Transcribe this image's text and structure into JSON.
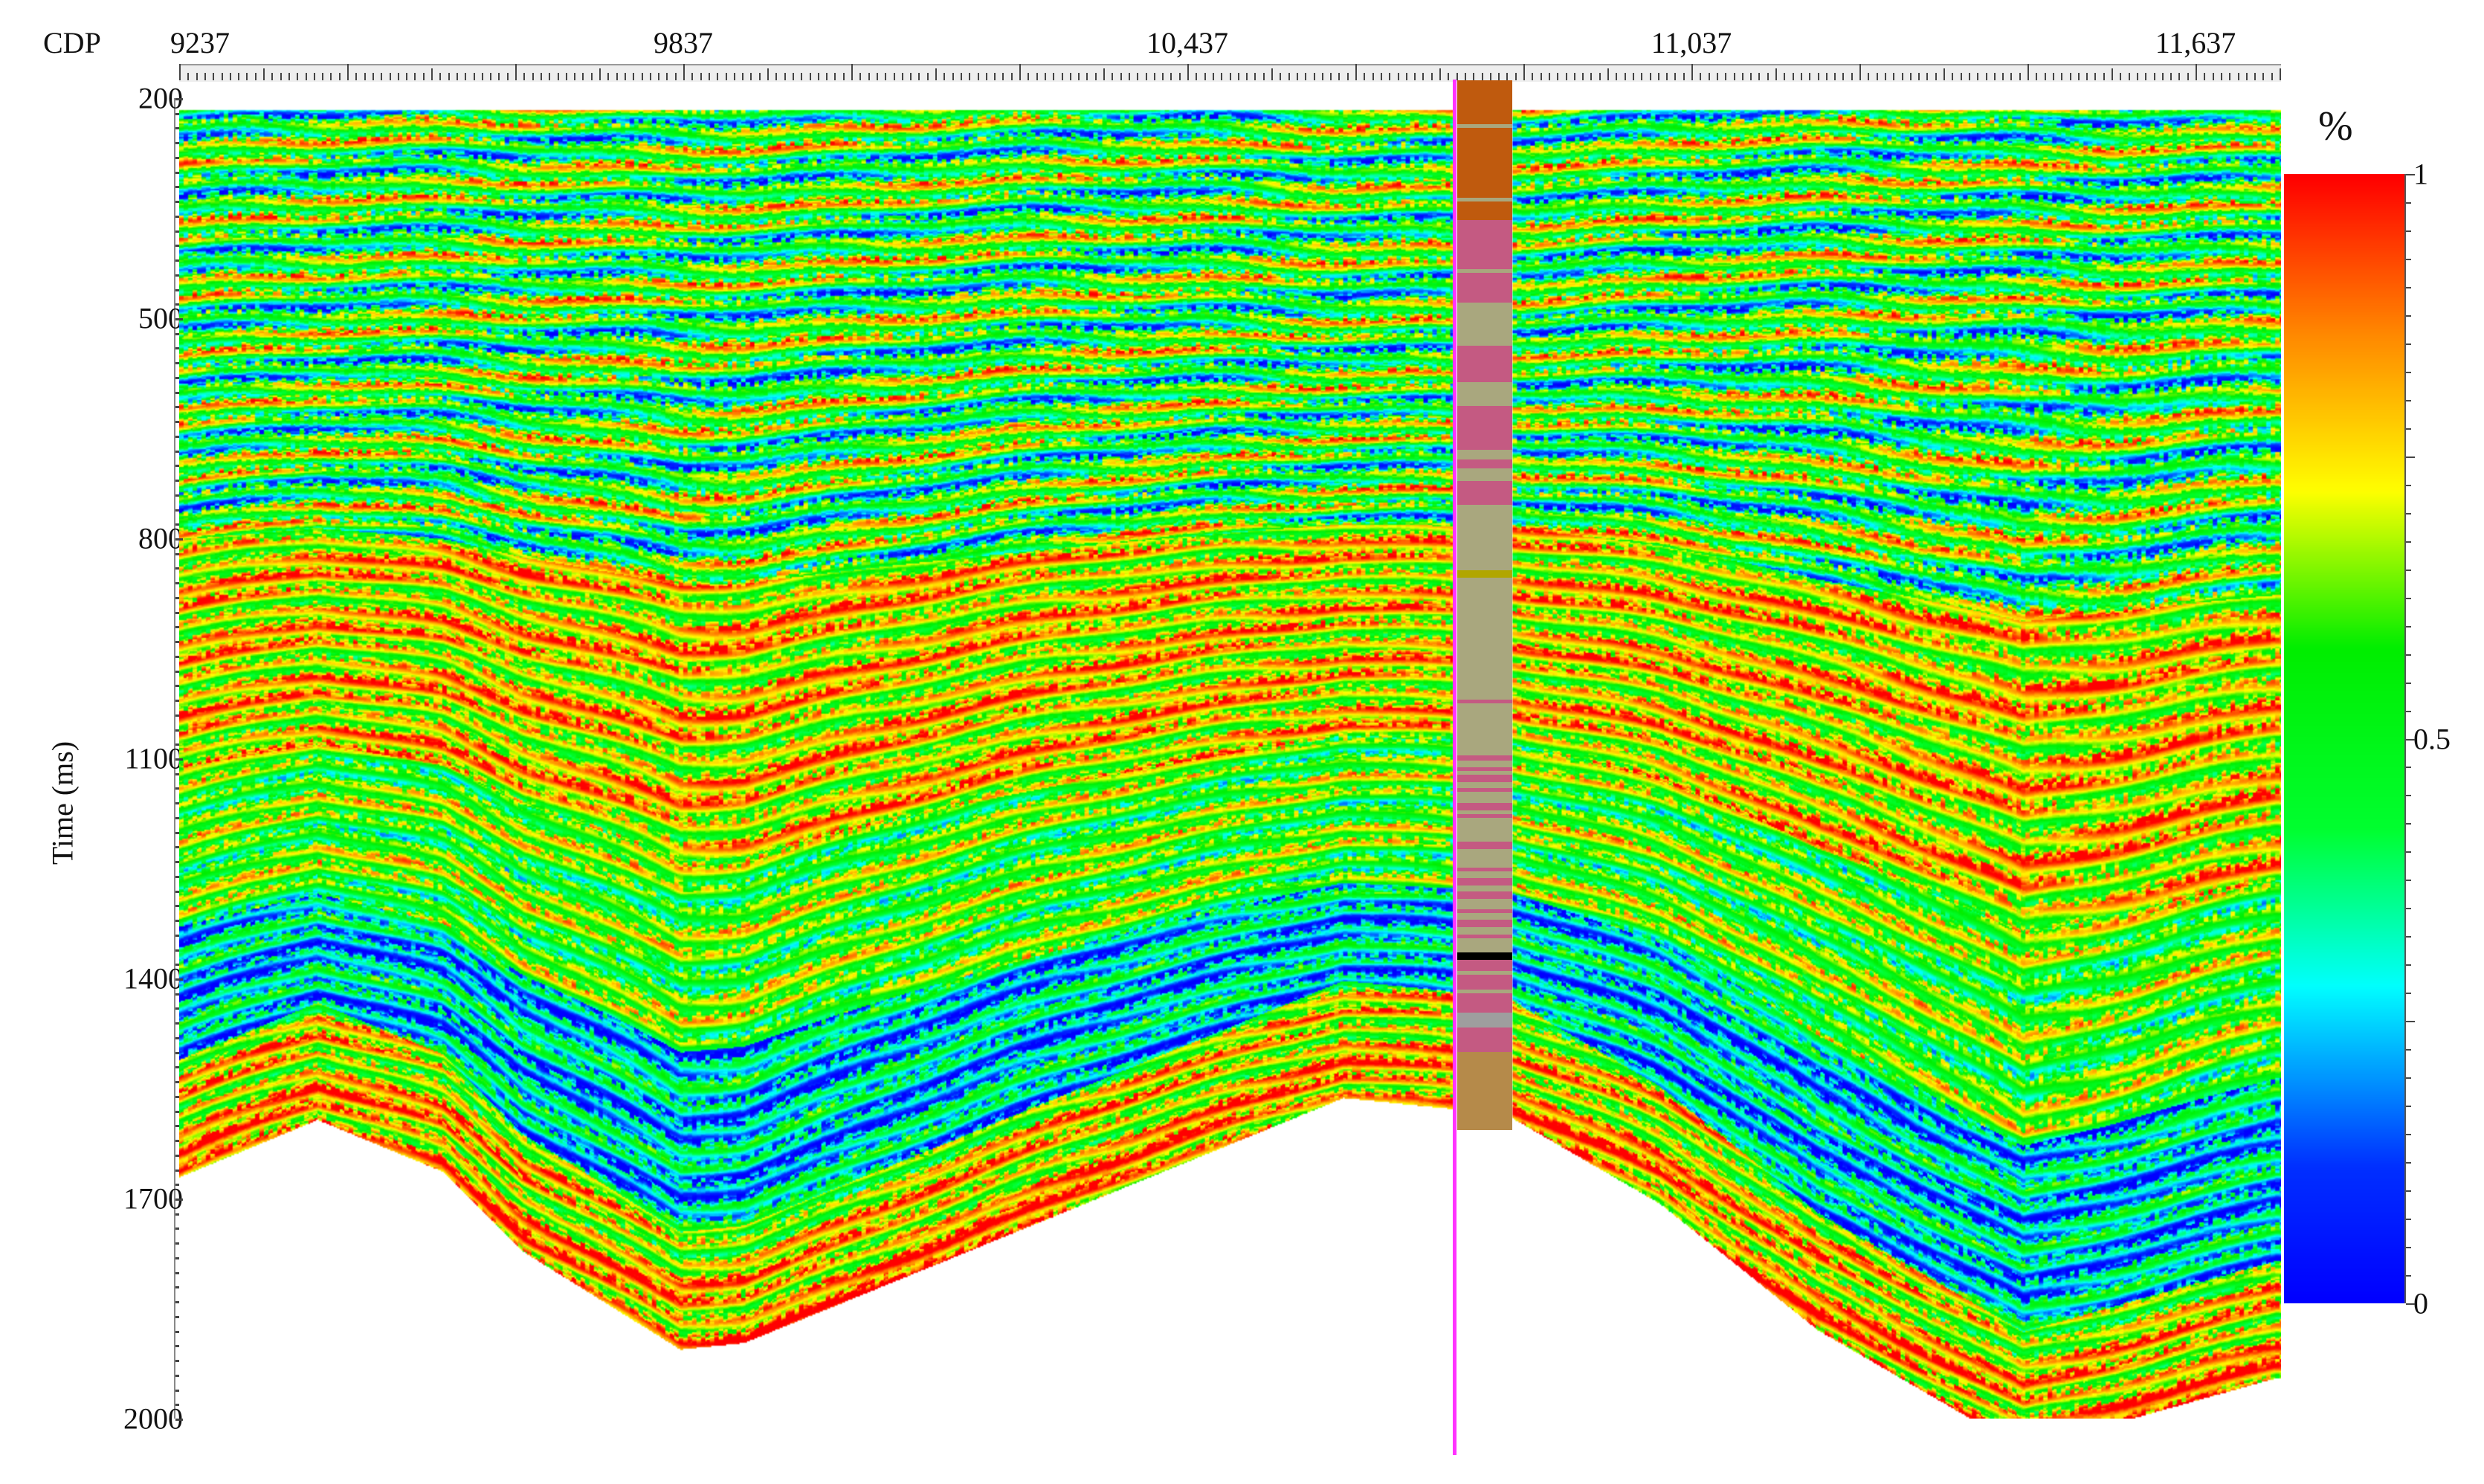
{
  "chart_data": {
    "type": "heatmap",
    "title": "",
    "xlabel": "CDP",
    "ylabel": "Time (ms)",
    "x_ticks": [
      "9237",
      "9837",
      "10,437",
      "11,037",
      "11,637"
    ],
    "x_tick_values": [
      9237,
      9837,
      10437,
      11037,
      11637
    ],
    "y_ticks": [
      "200",
      "500",
      "800",
      "1100",
      "1400",
      "1700",
      "2000"
    ],
    "y_tick_values": [
      200,
      500,
      800,
      1100,
      1400,
      1700,
      2000
    ],
    "xlim": [
      9237,
      11737
    ],
    "ylim": [
      200,
      2000
    ],
    "data_top_time": 215,
    "data_bottom_boundary": [
      [
        9237,
        1670
      ],
      [
        9401,
        1592
      ],
      [
        9551,
        1663
      ],
      [
        9645,
        1771
      ],
      [
        9833,
        1905
      ],
      [
        9909,
        1896
      ],
      [
        10623,
        1562
      ],
      [
        10751,
        1577
      ],
      [
        10821,
        1588
      ],
      [
        10999,
        1706
      ],
      [
        11188,
        1879
      ],
      [
        11432,
        2041
      ],
      [
        11733,
        1944
      ]
    ],
    "colorbar": {
      "unit": "%",
      "ticks": [
        "1",
        "0.5",
        "0"
      ],
      "tick_values": [
        1,
        0.5,
        0
      ],
      "range": [
        0,
        1
      ],
      "colormap": [
        [
          0,
          "#0000ff"
        ],
        [
          0.12,
          "#0030ff"
        ],
        [
          0.28,
          "#00ffff"
        ],
        [
          0.42,
          "#00ff30"
        ],
        [
          0.58,
          "#00ee00"
        ],
        [
          0.72,
          "#ffff00"
        ],
        [
          0.86,
          "#ff8800"
        ],
        [
          1,
          "#ff0000"
        ]
      ]
    },
    "well": {
      "cdp": 10800,
      "top_time": 176,
      "bottom_time": 1607,
      "colors": {
        "brown": "#bf5a0e",
        "pink": "#c45a82",
        "tan": "#a9a77e",
        "olive": "#b1a600",
        "gray": "#9e9e9e",
        "black": "#000000",
        "base": "#b58a4a"
      },
      "bands": [
        [
          176,
          235,
          "brown"
        ],
        [
          235,
          241,
          "tan"
        ],
        [
          241,
          336,
          "brown"
        ],
        [
          336,
          341,
          "tan"
        ],
        [
          341,
          366,
          "brown"
        ],
        [
          366,
          433,
          "pink"
        ],
        [
          433,
          438,
          "tan"
        ],
        [
          438,
          479,
          "pink"
        ],
        [
          479,
          538,
          "tan"
        ],
        [
          538,
          587,
          "pink"
        ],
        [
          587,
          620,
          "tan"
        ],
        [
          620,
          679,
          "pink"
        ],
        [
          679,
          693,
          "tan"
        ],
        [
          693,
          705,
          "pink"
        ],
        [
          705,
          722,
          "tan"
        ],
        [
          722,
          754,
          "pink"
        ],
        [
          754,
          844,
          "tan"
        ],
        [
          844,
          854,
          "olive"
        ],
        [
          854,
          1020,
          "tan"
        ],
        [
          1020,
          1025,
          "pink"
        ],
        [
          1025,
          1365,
          "tan"
        ],
        [
          1096,
          1103,
          "pink"
        ],
        [
          1112,
          1117,
          "pink"
        ],
        [
          1122,
          1132,
          "pink"
        ],
        [
          1141,
          1146,
          "pink"
        ],
        [
          1161,
          1171,
          "pink"
        ],
        [
          1176,
          1181,
          "pink"
        ],
        [
          1214,
          1224,
          "pink"
        ],
        [
          1249,
          1254,
          "pink"
        ],
        [
          1263,
          1273,
          "pink"
        ],
        [
          1281,
          1292,
          "pink"
        ],
        [
          1306,
          1311,
          "pink"
        ],
        [
          1320,
          1330,
          "pink"
        ],
        [
          1340,
          1345,
          "pink"
        ],
        [
          1365,
          1375,
          "black"
        ],
        [
          1375,
          1447,
          "pink"
        ],
        [
          1390,
          1395,
          "tan"
        ],
        [
          1415,
          1420,
          "tan"
        ],
        [
          1447,
          1467,
          "gray"
        ],
        [
          1467,
          1500,
          "pink"
        ],
        [
          1500,
          1607,
          "base"
        ]
      ]
    }
  }
}
